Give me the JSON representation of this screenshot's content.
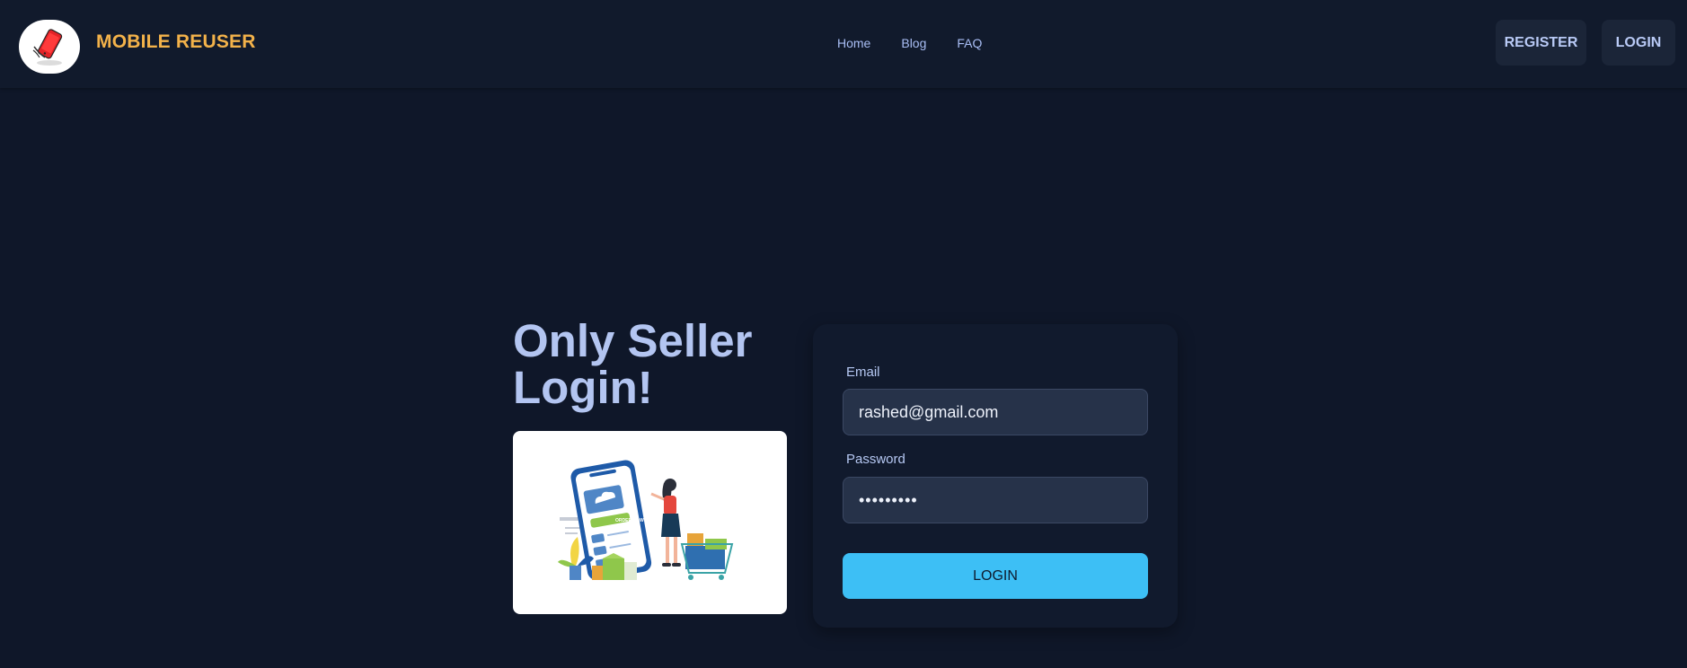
{
  "header": {
    "brand": "MOBILE REUSER",
    "logo_icon": "phone-icon",
    "nav": [
      {
        "label": "Home"
      },
      {
        "label": "Blog"
      },
      {
        "label": "FAQ"
      }
    ],
    "register_label": "REGISTER",
    "login_label": "LOGIN"
  },
  "hero": {
    "title": "Only Seller Login!",
    "illustration": "online-shopping-illustration",
    "illustration_text": "ORDER NOW"
  },
  "form": {
    "email_label": "Email",
    "email_value": "rashed@gmail.com",
    "password_label": "Password",
    "password_value": "•••••••••",
    "submit_label": "LOGIN"
  },
  "colors": {
    "background": "#0f1729",
    "navbar": "#111a2c",
    "brand": "#f3b24a",
    "accent_button": "#3dbff5",
    "title": "#b3c5f1"
  }
}
